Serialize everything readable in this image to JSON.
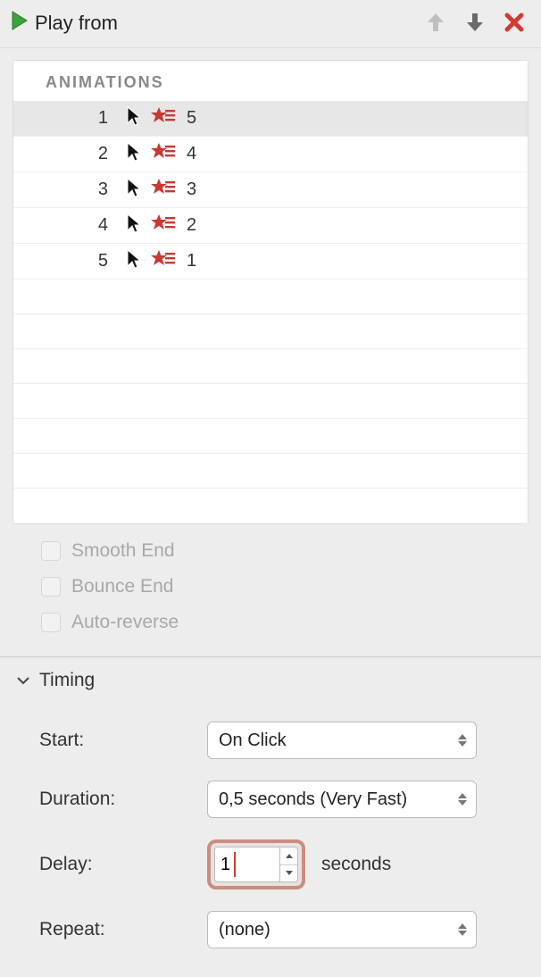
{
  "toolbar": {
    "play_label": "Play from"
  },
  "animations": {
    "header": "ANIMATIONS",
    "rows": [
      {
        "idx": "1",
        "label": "5",
        "selected": true
      },
      {
        "idx": "2",
        "label": "4",
        "selected": false
      },
      {
        "idx": "3",
        "label": "3",
        "selected": false
      },
      {
        "idx": "4",
        "label": "2",
        "selected": false
      },
      {
        "idx": "5",
        "label": "1",
        "selected": false
      }
    ]
  },
  "effects": {
    "smooth_end": "Smooth End",
    "bounce_end": "Bounce End",
    "auto_reverse": "Auto-reverse"
  },
  "timing": {
    "section_title": "Timing",
    "start_label": "Start:",
    "start_value": "On Click",
    "duration_label": "Duration:",
    "duration_value": "0,5 seconds (Very Fast)",
    "delay_label": "Delay:",
    "delay_value": "1",
    "delay_unit": "seconds",
    "repeat_label": "Repeat:",
    "repeat_value": "(none)"
  },
  "colors": {
    "accent_green": "#3aa33a",
    "accent_red": "#c63a31",
    "close_red": "#d23b30",
    "arrow_disabled": "#bfbfbf",
    "arrow_enabled": "#6a6a6a",
    "highlight_ring": "#c98e7e"
  }
}
